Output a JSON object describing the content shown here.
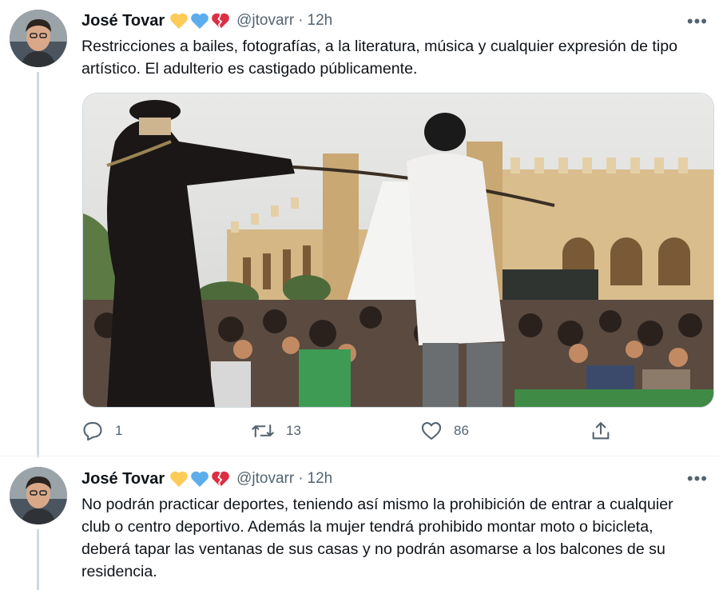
{
  "tweets": [
    {
      "author_name": "José Tovar",
      "handle": "@jtovarr",
      "separator": "·",
      "time": "12h",
      "emojis": [
        "yellow-heart",
        "blue-heart",
        "broken-heart"
      ],
      "text": "Restricciones a bailes, fotografías, a la literatura, música y cualquier expresión de tipo artístico. El adulterio es castigado públicamente.",
      "has_media": true,
      "stats": {
        "replies": "1",
        "retweets": "13",
        "likes": "86"
      }
    },
    {
      "author_name": "José Tovar",
      "handle": "@jtovarr",
      "separator": "·",
      "time": "12h",
      "emojis": [
        "yellow-heart",
        "blue-heart",
        "broken-heart"
      ],
      "text": "No podrán practicar deportes, teniendo así mismo la prohibición de entrar a cualquier club o centro deportivo. Además la mujer tendrá prohibido montar moto o bicicleta, deberá tapar las ventanas de sus casas y no podrán asomarse a los balcones de su residencia.",
      "has_media": false
    }
  ],
  "ui": {
    "more_label": "•••"
  },
  "colors": {
    "text_primary": "#0f1419",
    "text_secondary": "#536471",
    "thread_line": "#cfd9de"
  }
}
